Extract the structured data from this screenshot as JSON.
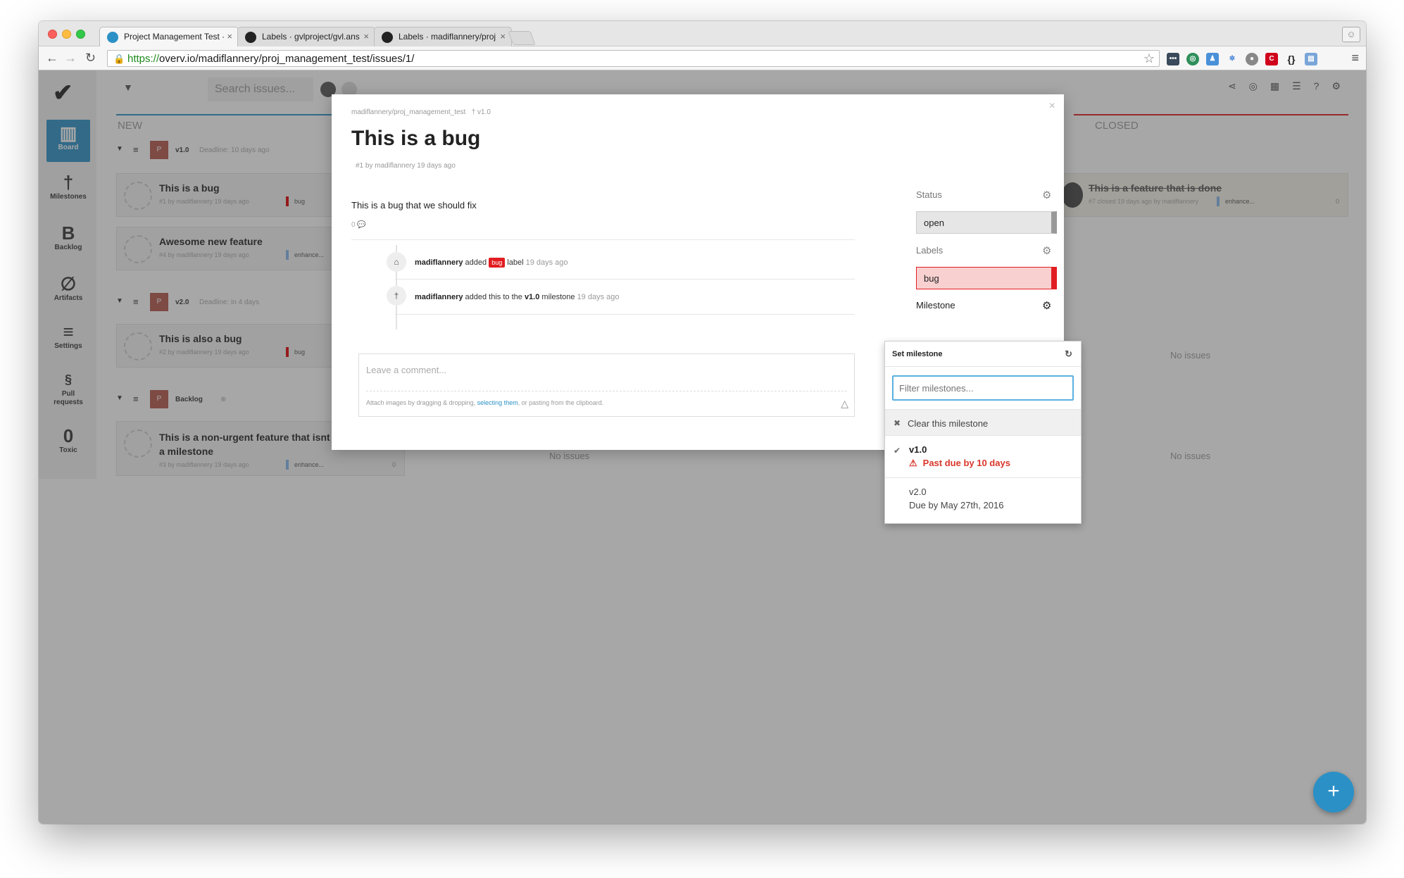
{
  "browser": {
    "tabs": [
      {
        "title": "Project Management Test ·"
      },
      {
        "title": "Labels · gvlproject/gvl.ans"
      },
      {
        "title": "Labels · madiflannery/proj"
      }
    ],
    "url_proto": "https://",
    "url_rest": "overv.io/madiflannery/proj_management_test/issues/1/"
  },
  "sidebar": {
    "items": [
      {
        "icon": "▥",
        "label": "Board"
      },
      {
        "icon": "†",
        "label": "Milestones"
      },
      {
        "icon": "B",
        "label": "Backlog"
      },
      {
        "icon": "∅",
        "label": "Artifacts"
      },
      {
        "icon": "≡",
        "label": "Settings"
      },
      {
        "icon": "§",
        "label": "Pull requests"
      },
      {
        "icon": "0",
        "label": "Toxic"
      }
    ]
  },
  "topbar": {
    "search_placeholder": "Search issues..."
  },
  "board": {
    "columns": [
      "NEW",
      "CLOSED"
    ],
    "groups": [
      {
        "name": "v1.0",
        "deadline": "Deadline: 10 days ago",
        "badge": "P"
      },
      {
        "name": "v2.0",
        "deadline": "Deadline: in 4 days",
        "badge": "P"
      },
      {
        "name": "Backlog",
        "deadline": "",
        "badge": "P"
      }
    ],
    "cards": [
      {
        "title": "This is a bug",
        "meta": "#1 by madiflannery 19 days ago",
        "label": "bug"
      },
      {
        "title": "Awesome new feature",
        "meta": "#4 by madiflannery 19 days ago",
        "label": "enhance..."
      },
      {
        "title": "This is also a bug",
        "meta": "#2 by madiflannery 19 days ago",
        "label": "bug"
      },
      {
        "title": "This is a non-urgent feature that isnt assigned to a milestone",
        "meta": "#3 by madiflannery 19 days ago",
        "label": "enhance...",
        "count": "0"
      }
    ],
    "closed_card": {
      "title": "This is a feature that is done",
      "meta": "#7 closed 19 days ago by madiflannery",
      "label": "enhance...",
      "count": "0"
    },
    "no_issues": "No issues"
  },
  "modal": {
    "repo": "madiflannery/proj_management_test",
    "milestone_tag": "v1.0",
    "title": "This is a bug",
    "meta": "#1 by madiflannery 19 days ago",
    "body": "This is a bug that we should fix",
    "comment_count": "0",
    "events": [
      {
        "user": "madiflannery",
        "pre": "added",
        "label": "bug",
        "post": "label",
        "time": "19 days ago"
      },
      {
        "user": "madiflannery",
        "pre": "added this to the",
        "milestone": "v1.0",
        "post": "milestone",
        "time": "19 days ago"
      }
    ],
    "comment_placeholder": "Leave a comment...",
    "comment_hint_pre": "Attach images by dragging & dropping,",
    "comment_hint_link": "selecting them",
    "comment_hint_post": ", or pasting from the clipboard.",
    "status_label": "Status",
    "status_value": "open",
    "labels_label": "Labels",
    "labels_value": "bug",
    "milestone_label": "Milestone"
  },
  "milestone_dropdown": {
    "header": "Set milestone",
    "filter_placeholder": "Filter milestones...",
    "clear": "Clear this milestone",
    "options": [
      {
        "name": "v1.0",
        "note": "Past due by 10 days",
        "selected": true
      },
      {
        "name": "v2.0",
        "note": "Due by May 27th, 2016",
        "selected": false
      }
    ]
  },
  "colors": {
    "accent": "#2b90c6",
    "bug": "#e11d21",
    "enhancement": "#84b6eb",
    "overdue": "#d9362a"
  }
}
